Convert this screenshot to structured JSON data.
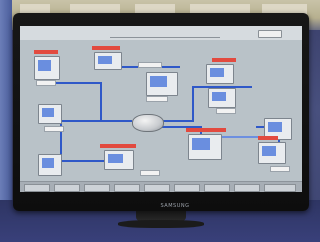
{
  "scene": {
    "description_kind": "photo of a monitor showing a SCADA process screen",
    "colors": {
      "pipe": "#2f58c8",
      "alarm_label": "#e24a3f",
      "screen_bg": "#b9c2c8",
      "monitor_bezel": "#171717"
    }
  },
  "monitor": {
    "brand": "SAMSUNG"
  }
}
